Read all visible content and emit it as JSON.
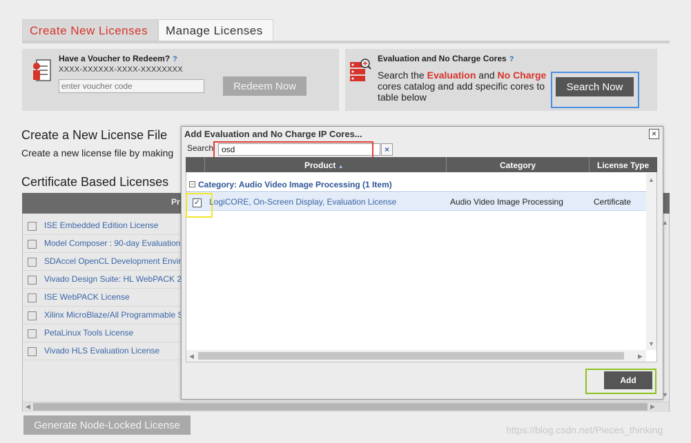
{
  "tabs": [
    {
      "label": "Create New Licenses",
      "active": true
    },
    {
      "label": "Manage Licenses",
      "active": false
    }
  ],
  "voucher": {
    "title": "Have a Voucher to Redeem?",
    "help": "?",
    "format": "XXXX-XXXXXX-XXXX-XXXXXXXX",
    "placeholder": "enter voucher code",
    "button": "Redeem Now"
  },
  "evaluation": {
    "title": "Evaluation and No Charge Cores",
    "help": "?",
    "desc_1": "Search the ",
    "desc_eval": "Evaluation",
    "desc_2": " and ",
    "desc_nocharge": "No Charge",
    "desc_3": " cores catalog and add specific cores to table below",
    "button": "Search Now"
  },
  "create_section": {
    "heading": "Create a New License File",
    "sub": "Create a new license file by making"
  },
  "cert_section": {
    "heading": "Certificate Based Licenses",
    "header_label": "Pr",
    "rows": [
      "ISE Embedded Edition License",
      "Model Composer : 90-day Evaluation",
      "SDAccel OpenCL Development Envir",
      "Vivado Design Suite: HL WebPACK 2",
      "ISE WebPACK License",
      "Xilinx MicroBlaze/All Programmable S",
      "PetaLinux Tools License",
      "Vivado HLS Evaluation License"
    ],
    "generate_button": "Generate Node-Locked License"
  },
  "dialog": {
    "title": "Add Evaluation and No Charge IP Cores...",
    "close": "×",
    "search_label": "Search",
    "search_value": "osd",
    "clear": "×",
    "columns": [
      "Product",
      "Category",
      "License Type"
    ],
    "sort_indicator": "▲",
    "group": {
      "toggle": "−",
      "label": "Category: Audio Video Image Processing (1 Item)"
    },
    "row": {
      "checked": true,
      "check_glyph": "✓",
      "product": "LogiCORE, On-Screen Display, Evaluation License",
      "category": "Audio Video Image Processing",
      "license_type": "Certificate"
    },
    "add_button": "Add"
  },
  "watermark": "https://blog.csdn.net/Pieces_thinking",
  "colors": {
    "accent_red": "#d6332b",
    "link_blue": "#3b66a8",
    "frame_blue": "#4a90e2",
    "frame_red": "#e0403a",
    "frame_yellow": "#f0e630",
    "frame_green": "#8cc21a"
  }
}
